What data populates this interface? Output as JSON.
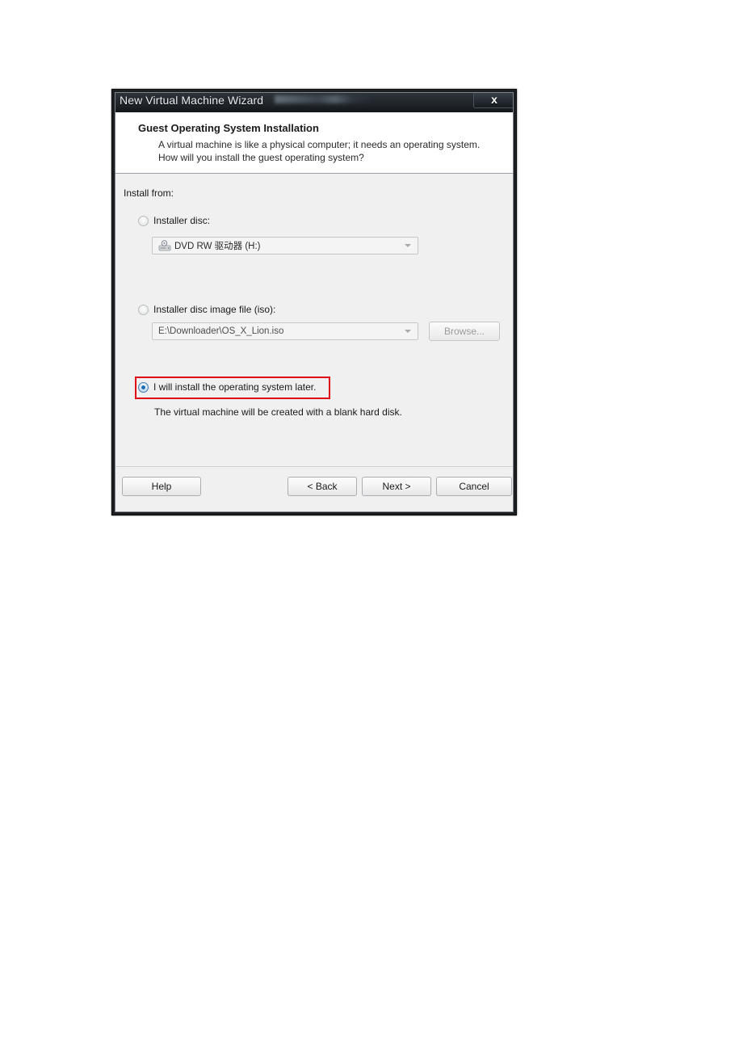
{
  "window": {
    "title": "New Virtual Machine Wizard",
    "close_icon": "close-icon",
    "close_glyph": "x"
  },
  "header": {
    "title": "Guest Operating System Installation",
    "description": "A virtual machine is like a physical computer; it needs an operating system. How will you install the guest operating system?"
  },
  "body": {
    "install_from_label": "Install from:",
    "options": [
      {
        "id": "installer-disc",
        "label": "Installer disc:",
        "selected": false,
        "combo_value": "DVD RW 驱动器 (H:)",
        "combo_icon": "optical-drive-icon"
      },
      {
        "id": "installer-iso",
        "label": "Installer disc image file (iso):",
        "selected": false,
        "combo_value": "E:\\Downloader\\OS_X_Lion.iso",
        "browse_label": "Browse..."
      },
      {
        "id": "install-later",
        "label": "I will install the operating system later.",
        "selected": true,
        "description": "The virtual machine will be created with a blank hard disk."
      }
    ],
    "highlight_color": "#e00014"
  },
  "footer": {
    "help_label": "Help",
    "back_label": "< Back",
    "next_label": "Next >",
    "cancel_label": "Cancel"
  }
}
